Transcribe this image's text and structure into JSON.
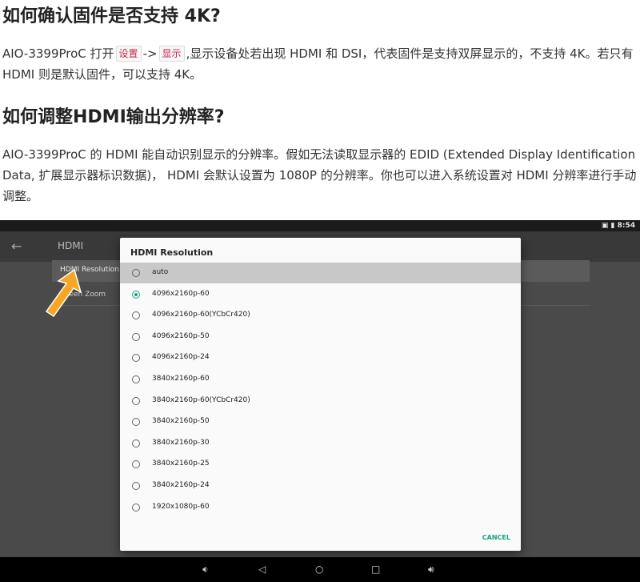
{
  "heading1": "如何确认固件是否支持 4K?",
  "para1": {
    "before": "AIO-3399ProC 打开",
    "code1": "设置",
    "arrow": "->",
    "code2": "显示",
    "after": ",显示设备处若出现 HDMI 和 DSI，代表固件是支持双屏显示的，不支持 4K。若只有 HDMI 则是默认固件，可以支持 4K。"
  },
  "heading2": "如何调整HDMI输出分辨率?",
  "para2": "AIO-3399ProC 的 HDMI 能自动识别显示的分辨率。假如无法读取显示器的 EDID (Extended Display Identification Data, 扩展显示器标识数据)， HDMI 会默认设置为 1080P 的分辨率。你也可以进入系统设置对 HDMI 分辨率进行手动调整。",
  "screenshot": {
    "status_time": "8:54",
    "status_icons": "▣ ▮",
    "back_icon": "←",
    "app_title": "HDMI",
    "row_resolution": "HDMI Resolution",
    "row_zoom": "creen Zoom",
    "dialog": {
      "title": "HDMI Resolution",
      "options": [
        {
          "label": "auto",
          "highlighted": true,
          "checked": false
        },
        {
          "label": "4096x2160p-60",
          "highlighted": false,
          "checked": true
        },
        {
          "label": "4096x2160p-60(YCbCr420)",
          "highlighted": false,
          "checked": false
        },
        {
          "label": "4096x2160p-50",
          "highlighted": false,
          "checked": false
        },
        {
          "label": "4096x2160p-24",
          "highlighted": false,
          "checked": false
        },
        {
          "label": "3840x2160p-60",
          "highlighted": false,
          "checked": false
        },
        {
          "label": "3840x2160p-60(YCbCr420)",
          "highlighted": false,
          "checked": false
        },
        {
          "label": "3840x2160p-50",
          "highlighted": false,
          "checked": false
        },
        {
          "label": "3840x2160p-30",
          "highlighted": false,
          "checked": false
        },
        {
          "label": "3840x2160p-25",
          "highlighted": false,
          "checked": false
        },
        {
          "label": "3840x2160p-24",
          "highlighted": false,
          "checked": false
        },
        {
          "label": "1920x1080p-60",
          "highlighted": false,
          "checked": false
        }
      ],
      "cancel_label": "CANCEL"
    },
    "nav_icons": [
      "volume-down-icon",
      "back-triangle-icon",
      "home-circle-icon",
      "recents-square-icon",
      "volume-up-icon"
    ],
    "accent_color": "#16a082",
    "arrow_color": "#f5a623"
  }
}
